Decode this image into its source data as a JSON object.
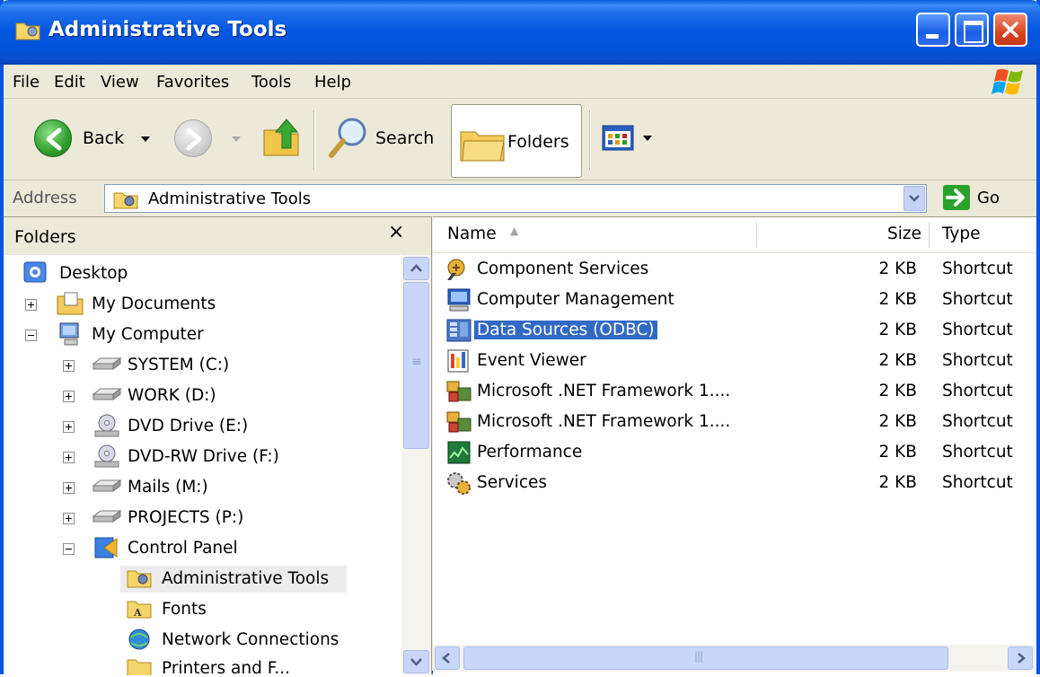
{
  "window": {
    "title": "Administrative Tools"
  },
  "menu": [
    "File",
    "Edit",
    "View",
    "Favorites",
    "Tools",
    "Help"
  ],
  "toolbar": {
    "back_label": "Back",
    "search_label": "Search",
    "folders_label": "Folders"
  },
  "address": {
    "label": "Address",
    "value": "Administrative Tools",
    "go_label": "Go"
  },
  "folders_pane": {
    "title": "Folders",
    "close_glyph": "×",
    "tree": [
      {
        "label": "Desktop",
        "icon": "desktop-icon",
        "expander": ""
      },
      {
        "label": "My Documents",
        "icon": "my-documents-icon",
        "expander": "plus"
      },
      {
        "label": "My Computer",
        "icon": "my-computer-icon",
        "expander": "minus"
      },
      {
        "label": "SYSTEM (C:)",
        "icon": "drive-icon",
        "expander": "plus"
      },
      {
        "label": "WORK (D:)",
        "icon": "drive-icon",
        "expander": "plus"
      },
      {
        "label": "DVD Drive (E:)",
        "icon": "dvd-drive-icon",
        "expander": "plus"
      },
      {
        "label": "DVD-RW Drive (F:)",
        "icon": "dvd-drive-icon",
        "expander": "plus"
      },
      {
        "label": "Mails (M:)",
        "icon": "drive-icon",
        "expander": "plus"
      },
      {
        "label": "PROJECTS (P:)",
        "icon": "drive-icon",
        "expander": "plus"
      },
      {
        "label": "Control Panel",
        "icon": "control-panel-icon",
        "expander": "minus"
      },
      {
        "label": "Administrative Tools",
        "icon": "admin-tools-icon",
        "expander": ""
      },
      {
        "label": "Fonts",
        "icon": "fonts-folder-icon",
        "expander": ""
      },
      {
        "label": "Network Connections",
        "icon": "network-connections-icon",
        "expander": ""
      },
      {
        "label": "Printers and F...",
        "icon": "printers-icon",
        "expander": ""
      }
    ]
  },
  "list": {
    "columns": {
      "name": "Name",
      "size": "Size",
      "type": "Type"
    },
    "sort_glyph": "▲",
    "files": [
      {
        "name": "Component Services",
        "size": "2 KB",
        "type": "Shortcut"
      },
      {
        "name": "Computer Management",
        "size": "2 KB",
        "type": "Shortcut"
      },
      {
        "name": "Data Sources (ODBC)",
        "size": "2 KB",
        "type": "Shortcut"
      },
      {
        "name": "Event Viewer",
        "size": "2 KB",
        "type": "Shortcut"
      },
      {
        "name": "Microsoft .NET Framework 1....",
        "size": "2 KB",
        "type": "Shortcut"
      },
      {
        "name": "Microsoft .NET Framework 1....",
        "size": "2 KB",
        "type": "Shortcut"
      },
      {
        "name": "Performance",
        "size": "2 KB",
        "type": "Shortcut"
      },
      {
        "name": "Services",
        "size": "2 KB",
        "type": "Shortcut"
      }
    ],
    "selected_file": "Data Sources (ODBC)"
  },
  "colors": {
    "titlebar": "#0558E0",
    "selection": "#316AC5",
    "chrome": "#ECE9D8"
  }
}
